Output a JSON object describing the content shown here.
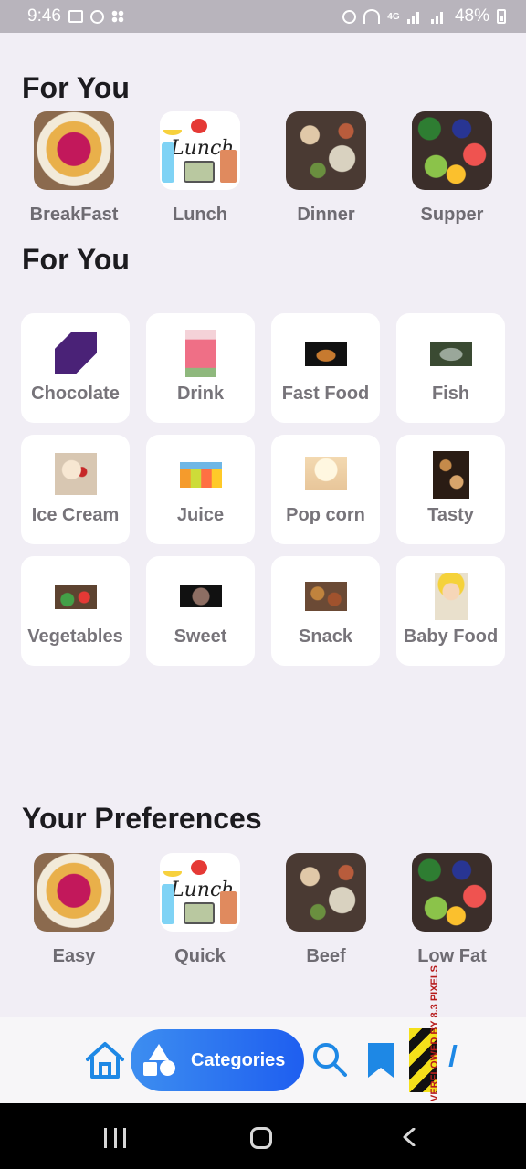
{
  "status_bar": {
    "time": "9:46",
    "network": "4G",
    "battery": "48%"
  },
  "section1": {
    "title": "For You",
    "items": [
      {
        "label": "BreakFast",
        "image": "bowl"
      },
      {
        "label": "Lunch",
        "image": "lunch"
      },
      {
        "label": "Dinner",
        "image": "dinner"
      },
      {
        "label": "Supper",
        "image": "supper"
      }
    ]
  },
  "section2": {
    "title": "For You",
    "categories": [
      {
        "label": "Chocolate"
      },
      {
        "label": "Drink"
      },
      {
        "label": "Fast Food"
      },
      {
        "label": "Fish"
      },
      {
        "label": "Ice Cream"
      },
      {
        "label": "Juice"
      },
      {
        "label": "Pop corn"
      },
      {
        "label": "Tasty"
      },
      {
        "label": "Vegetables"
      },
      {
        "label": "Sweet"
      },
      {
        "label": "Snack"
      },
      {
        "label": "Baby Food"
      }
    ]
  },
  "lunch_image_text": "Lunch",
  "preferences": {
    "title": "Your Preferences",
    "items": [
      {
        "label": "Easy",
        "image": "bowl"
      },
      {
        "label": "Quick",
        "image": "lunch"
      },
      {
        "label": "Beef",
        "image": "dinner"
      },
      {
        "label": "Low Fat",
        "image": "supper"
      }
    ]
  },
  "bottom_nav": {
    "active_label": "Categories",
    "overflow_warning": "VERFLOWED BY 8.3 PIXELS",
    "icons": [
      "home-icon",
      "categories-icon",
      "search-icon",
      "bookmark-icon"
    ],
    "accent": "#1e88e5",
    "active_gradient": [
      "#3d8ef0",
      "#1e5ef0"
    ]
  },
  "colors": {
    "background": "#f1eef5",
    "card": "#ffffff",
    "label": "#6e6b72"
  }
}
